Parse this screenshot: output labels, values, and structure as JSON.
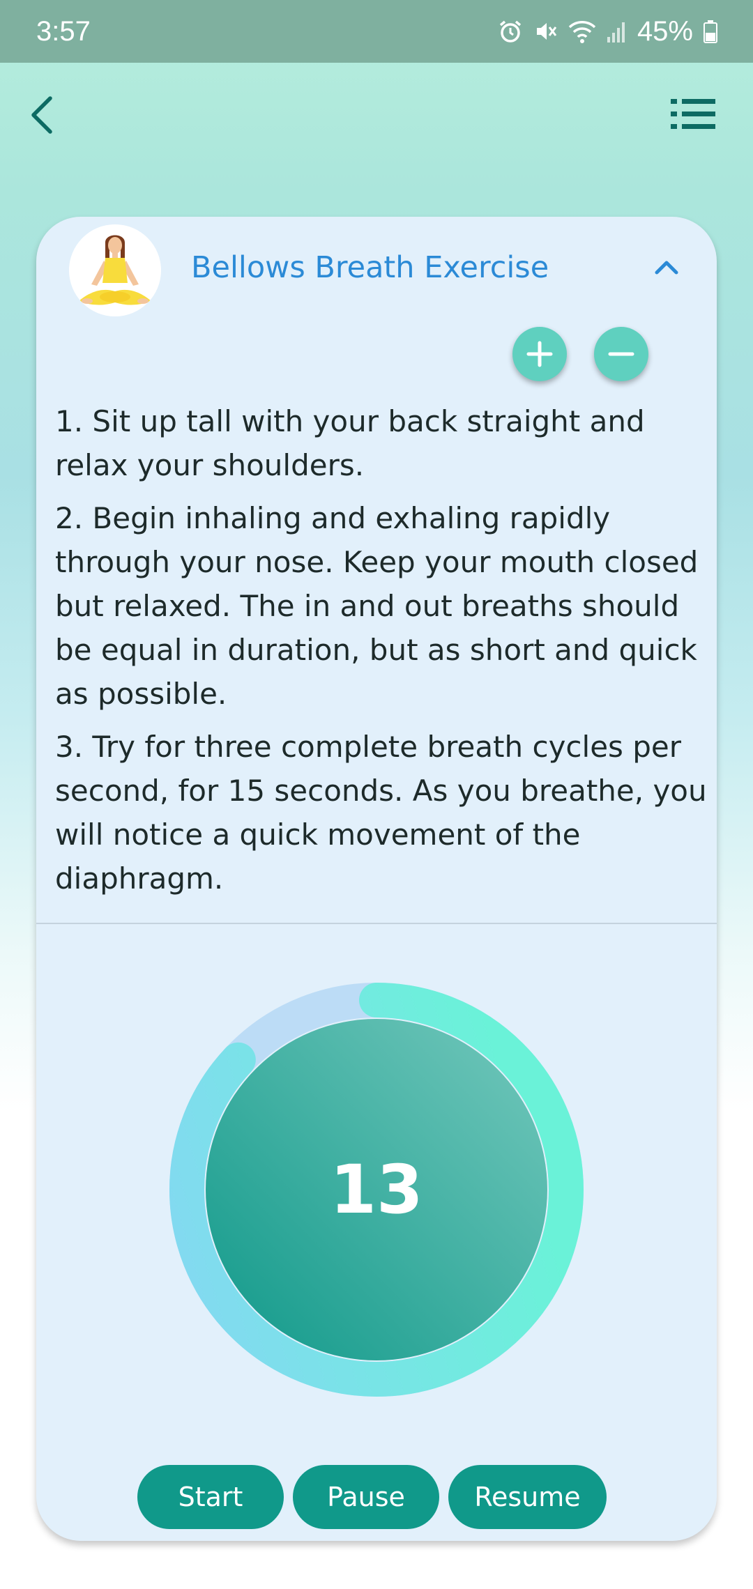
{
  "status_bar": {
    "time": "3:57",
    "battery": "45%",
    "icons": [
      "alarm-icon",
      "mute-icon",
      "wifi-icon",
      "signal-icon",
      "battery-icon"
    ]
  },
  "app_bar": {
    "back_icon": "chevron-left-icon",
    "menu_icon": "list-icon"
  },
  "card": {
    "title": "Bellows Breath Exercise",
    "avatar_icon": "meditation-avatar",
    "collapse_icon": "chevron-up-icon",
    "plus_icon": "plus-icon",
    "minus_icon": "minus-icon",
    "instructions": [
      "1. Sit up tall with your back straight and relax your shoulders.",
      "2. Begin inhaling and exhaling rapidly through your nose. Keep your mouth closed but relaxed. The in and out breaths should be equal in duration, but as short and quick as possible.",
      "3. Try for three complete breath cycles per second, for 15 seconds. As you breathe, you will notice a quick movement of the diaphragm."
    ]
  },
  "timer": {
    "count": "13",
    "progress_fraction": 0.87
  },
  "controls": {
    "start_label": "Start",
    "pause_label": "Pause",
    "resume_label": "Resume"
  },
  "colors": {
    "status_bar": "#7fb09f",
    "card_bg": "#e2f0fb",
    "title": "#2b8ad6",
    "button": "#10998a",
    "round_button": "#5fd0bf"
  }
}
